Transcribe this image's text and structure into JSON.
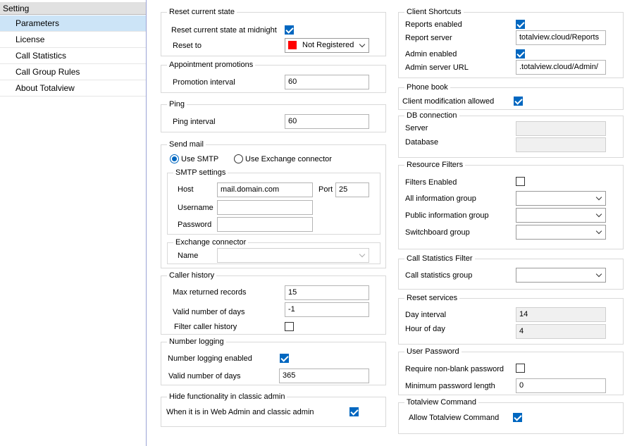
{
  "sidebar": {
    "header": "Setting",
    "items": [
      {
        "label": "Parameters"
      },
      {
        "label": "License"
      },
      {
        "label": "Call Statistics"
      },
      {
        "label": "Call Group Rules"
      },
      {
        "label": "About Totalview"
      }
    ]
  },
  "reset_state": {
    "title": "Reset current state",
    "midnight_label": "Reset current state at midnight",
    "midnight_checked": true,
    "reset_to_label": "Reset to",
    "reset_to_value": "Not Registered",
    "reset_to_color": "#ff0000"
  },
  "appointment": {
    "title": "Appointment promotions",
    "interval_label": "Promotion interval",
    "interval_value": "60"
  },
  "ping": {
    "title": "Ping",
    "interval_label": "Ping interval",
    "interval_value": "60"
  },
  "send_mail": {
    "title": "Send mail",
    "use_smtp": "Use SMTP",
    "use_exchange": "Use Exchange connector",
    "smtp_selected": true,
    "smtp_title": "SMTP settings",
    "host_label": "Host",
    "host_value": "mail.domain.com",
    "port_label": "Port",
    "port_value": "25",
    "username_label": "Username",
    "username_value": "",
    "password_label": "Password",
    "password_value": "",
    "exchange_title": "Exchange connector",
    "name_label": "Name",
    "name_value": ""
  },
  "caller_history": {
    "title": "Caller history",
    "max_label": "Max returned records",
    "max_value": "15",
    "days_label": "Valid number of days",
    "days_value": "-1",
    "filter_label": "Filter caller history",
    "filter_checked": false
  },
  "number_logging": {
    "title": "Number logging",
    "enabled_label": "Number logging enabled",
    "enabled_checked": true,
    "days_label": "Valid number of days",
    "days_value": "365"
  },
  "hide_functionality": {
    "title": "Hide functionality in classic admin",
    "label": "When it is in Web Admin and classic admin",
    "checked": true
  },
  "client_shortcuts": {
    "title": "Client Shortcuts",
    "reports_enabled_label": "Reports enabled",
    "reports_enabled_checked": true,
    "report_server_label": "Report server",
    "report_server_value": "totalview.cloud/Reports",
    "admin_enabled_label": "Admin enabled",
    "admin_enabled_checked": true,
    "admin_url_label": "Admin server URL",
    "admin_url_value": ".totalview.cloud/Admin/"
  },
  "phone_book": {
    "title": "Phone book",
    "modification_label": "Client modification allowed",
    "modification_checked": true
  },
  "db_connection": {
    "title": "DB connection",
    "server_label": "Server",
    "server_value": "",
    "database_label": "Database",
    "database_value": ""
  },
  "resource_filters": {
    "title": "Resource Filters",
    "enabled_label": "Filters Enabled",
    "enabled_checked": false,
    "all_info_label": "All information group",
    "all_info_value": "",
    "public_info_label": "Public information group",
    "public_info_value": "",
    "switchboard_label": "Switchboard group",
    "switchboard_value": ""
  },
  "call_stats_filter": {
    "title": "Call Statistics Filter",
    "group_label": "Call statistics group",
    "group_value": ""
  },
  "reset_services": {
    "title": "Reset services",
    "day_interval_label": "Day interval",
    "day_interval_value": "14",
    "hour_label": "Hour of day",
    "hour_value": "4"
  },
  "user_password": {
    "title": "User Password",
    "nonblank_label": "Require non-blank password",
    "nonblank_checked": false,
    "minlen_label": "Minimum password length",
    "minlen_value": "0"
  },
  "totalview_command": {
    "title": "Totalview Command",
    "allow_label": "Allow Totalview Command",
    "allow_checked": true
  }
}
